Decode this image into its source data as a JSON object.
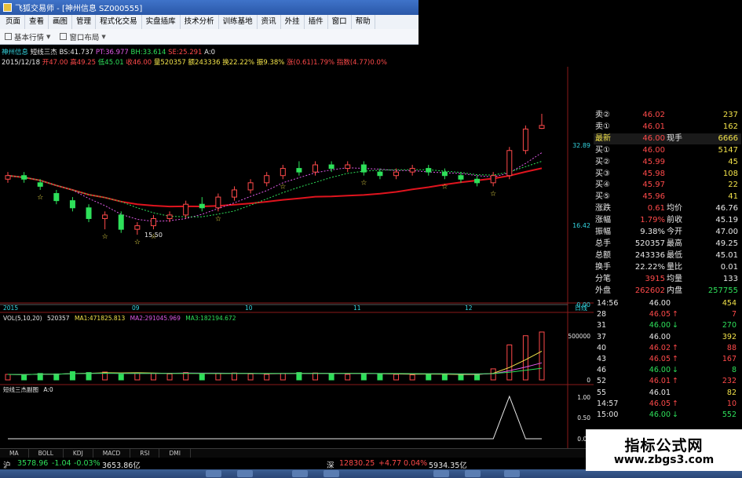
{
  "window": {
    "title": "飞狐交易师 - [神州信息 SZ000555]"
  },
  "menu": [
    "页面",
    "查看",
    "画图",
    "管理",
    "程式化交易",
    "实盘插库",
    "技术分析",
    "训练基地",
    "资讯",
    "外挂",
    "插件",
    "窗口",
    "帮助"
  ],
  "toolbar": {
    "basic_quote": "基本行情",
    "window_layout": "窗口布局"
  },
  "header": {
    "stock_name": "神州信息",
    "indicator": "短线三杰",
    "bs": "BS:41.737",
    "pt": "PT:36.977",
    "bh": "BH:33.614",
    "se": "SE:25.291",
    "a0": "A:0",
    "date": "2015/12/18",
    "open": "开47.00",
    "high": "高49.25",
    "low": "低45.01",
    "close": "收46.00",
    "volume": "量520357",
    "amount": "额243336",
    "turnover": "换22.22%",
    "amplitude": "振9.38%",
    "change": "涨(0.61)1.79%",
    "index": "指数(4.77)0.0%"
  },
  "price_chart": {
    "y_labels": [
      "32.89",
      "16.42",
      "0.00"
    ],
    "x_labels": [
      "2015",
      "09",
      "10",
      "11",
      "12"
    ],
    "low_annotation": "15.50",
    "period_label": "日线"
  },
  "volume_chart": {
    "title": "VOL(5,10,20)",
    "vol": "520357",
    "ma1": "MA1:471825.813",
    "ma2": "MA2:291045.969",
    "ma3": "MA3:182194.672",
    "y_labels": [
      "500000",
      "0"
    ]
  },
  "sub_chart": {
    "title": "短线三杰副图",
    "a0": "A:0",
    "y_labels": [
      "1.00",
      "0.50",
      "0.00"
    ]
  },
  "quote_panel": {
    "asks": [
      {
        "label": "卖②",
        "price": "46.02",
        "vol": "237"
      },
      {
        "label": "卖①",
        "price": "46.01",
        "vol": "162"
      }
    ],
    "latest": {
      "label": "最新",
      "price": "46.00",
      "label2": "现手",
      "vol": "6666"
    },
    "bids": [
      {
        "label": "买①",
        "price": "46.00",
        "vol": "5147"
      },
      {
        "label": "买②",
        "price": "45.99",
        "vol": "45"
      },
      {
        "label": "买③",
        "price": "45.98",
        "vol": "108"
      },
      {
        "label": "买④",
        "price": "45.97",
        "vol": "22"
      },
      {
        "label": "买⑤",
        "price": "45.96",
        "vol": "41"
      }
    ],
    "stats": [
      {
        "l1": "涨跌",
        "v1": "0.61",
        "l2": "均价",
        "v2": "46.76"
      },
      {
        "l1": "涨幅",
        "v1": "1.79%",
        "l2": "前收",
        "v2": "45.19"
      },
      {
        "l1": "振幅",
        "v1": "9.38%",
        "l2": "今开",
        "v2": "47.00"
      },
      {
        "l1": "总手",
        "v1": "520357",
        "l2": "最高",
        "v2": "49.25"
      },
      {
        "l1": "总额",
        "v1": "243336",
        "l2": "最低",
        "v2": "45.01"
      },
      {
        "l1": "换手",
        "v1": "22.22%",
        "l2": "量比",
        "v2": "0.01"
      },
      {
        "l1": "分笔",
        "v1": "3915",
        "l2": "均量",
        "v2": "133"
      },
      {
        "l1": "外盘",
        "v1": "262602",
        "l2": "内盘",
        "v2": "257755"
      }
    ]
  },
  "ticks": [
    {
      "time": "14:56",
      "price": "46.00",
      "arrow": "",
      "vol": "454"
    },
    {
      "time": "28",
      "price": "46.05",
      "arrow": "↑",
      "vol": "7"
    },
    {
      "time": "31",
      "price": "46.00",
      "arrow": "↓",
      "vol": "270"
    },
    {
      "time": "37",
      "price": "46.00",
      "arrow": "",
      "vol": "392"
    },
    {
      "time": "40",
      "price": "46.02",
      "arrow": "↑",
      "vol": "88"
    },
    {
      "time": "43",
      "price": "46.05",
      "arrow": "↑",
      "vol": "167"
    },
    {
      "time": "46",
      "price": "46.00",
      "arrow": "↓",
      "vol": "8"
    },
    {
      "time": "52",
      "price": "46.01",
      "arrow": "↑",
      "vol": "232"
    },
    {
      "time": "55",
      "price": "46.01",
      "arrow": "",
      "vol": "82"
    },
    {
      "time": "14:57",
      "price": "46.05",
      "arrow": "↑",
      "vol": "10"
    },
    {
      "time": "15:00",
      "price": "46.00",
      "arrow": "↓",
      "vol": "552"
    }
  ],
  "tabs": [
    "MA",
    "BOLL",
    "KDJ",
    "MACD",
    "RSI",
    "DMI"
  ],
  "status": {
    "sh_label": "沪",
    "sh_index": "3578.96",
    "sh_change": "-1.04",
    "sh_pct": "-0.03%",
    "sh_amount": "3653.86亿",
    "sz_label": "深",
    "sz_index": "12830.25",
    "sz_change": "+4.77",
    "sz_pct": "0.04%",
    "sz_amount": "5934.35亿"
  },
  "watermark": {
    "title": "指标公式网",
    "url": "www.zbgs3.com"
  },
  "colors": {
    "up": "#ff4a4a",
    "down": "#2ee05a",
    "accent": "#34d5e0",
    "ma_red": "#e0141e"
  },
  "chart_data": [
    {
      "type": "candlestick",
      "title": "短线三杰",
      "x_ticks": [
        "2015",
        "09",
        "10",
        "11",
        "12"
      ],
      "y_ticks": [
        0.0,
        16.42,
        32.89
      ],
      "ylim": [
        0,
        50
      ],
      "low_point": 15.5,
      "series": [
        {
          "values": [
            [
              31,
              33,
              30,
              32
            ],
            [
              32,
              33,
              30,
              31
            ],
            [
              30,
              31,
              28,
              29
            ],
            [
              27,
              28,
              24,
              25
            ],
            [
              25,
              26,
              22,
              23
            ],
            [
              23,
              24,
              19,
              20
            ],
            [
              20,
              22,
              17,
              21
            ],
            [
              21,
              22,
              16,
              17
            ],
            [
              17,
              19,
              15.5,
              18
            ],
            [
              18,
              21,
              17,
              20
            ],
            [
              20,
              22,
              19,
              21
            ],
            [
              21,
              25,
              20,
              24
            ],
            [
              24,
              26,
              22,
              23
            ],
            [
              23,
              27,
              22,
              26
            ],
            [
              26,
              29,
              25,
              28
            ],
            [
              28,
              31,
              27,
              30
            ],
            [
              30,
              33,
              29,
              32
            ],
            [
              32,
              35,
              31,
              34
            ],
            [
              34,
              36,
              32,
              33
            ],
            [
              33,
              36,
              32,
              35
            ],
            [
              35,
              36,
              33,
              34
            ],
            [
              34,
              36,
              33,
              35
            ],
            [
              35,
              36,
              32,
              33
            ],
            [
              33,
              34,
              31,
              32
            ],
            [
              32,
              34,
              31,
              33
            ],
            [
              33,
              35,
              32,
              34
            ],
            [
              34,
              35,
              32,
              33
            ],
            [
              33,
              34,
              31,
              32
            ],
            [
              32,
              33,
              30,
              31
            ],
            [
              31,
              32,
              29,
              30
            ],
            [
              30,
              33,
              29,
              32
            ],
            [
              32,
              40,
              31,
              39
            ],
            [
              39,
              46,
              38,
              45
            ],
            [
              45.19,
              49.25,
              45.01,
              46
            ]
          ]
        },
        {
          "name": "MA",
          "values": []
        }
      ]
    },
    {
      "type": "bar",
      "title": "VOL(5,10,20)",
      "ylim": [
        0,
        520357
      ],
      "y_ticks": [
        0,
        500000
      ],
      "series": [
        {
          "name": "VOL",
          "values": [
            60000,
            55000,
            70000,
            65000,
            90000,
            80000,
            85000,
            60000,
            75000,
            70000,
            65000,
            80000,
            60000,
            70000,
            75000,
            65000,
            60000,
            70000,
            80000,
            75000,
            65000,
            60000,
            70000,
            65000,
            60000,
            55000,
            65000,
            60000,
            55000,
            60000,
            120000,
            380000,
            480000,
            520357
          ]
        },
        {
          "name": "MA1",
          "values": [
            471825.813
          ]
        },
        {
          "name": "MA2",
          "values": [
            291045.969
          ]
        },
        {
          "name": "MA3",
          "values": [
            182194.672
          ]
        }
      ]
    },
    {
      "type": "line",
      "title": "短线三杰副图",
      "ylim": [
        0,
        1
      ],
      "y_ticks": [
        0.0,
        0.5,
        1.0
      ],
      "series": [
        {
          "name": "A",
          "values": [
            0,
            0,
            0,
            0,
            0,
            0,
            0,
            0,
            0,
            0,
            0,
            0,
            0,
            0,
            0,
            0,
            0,
            0,
            0,
            0,
            0,
            0,
            0,
            0,
            0,
            0,
            0,
            0,
            0,
            0,
            0,
            1,
            0,
            0
          ]
        }
      ]
    }
  ]
}
